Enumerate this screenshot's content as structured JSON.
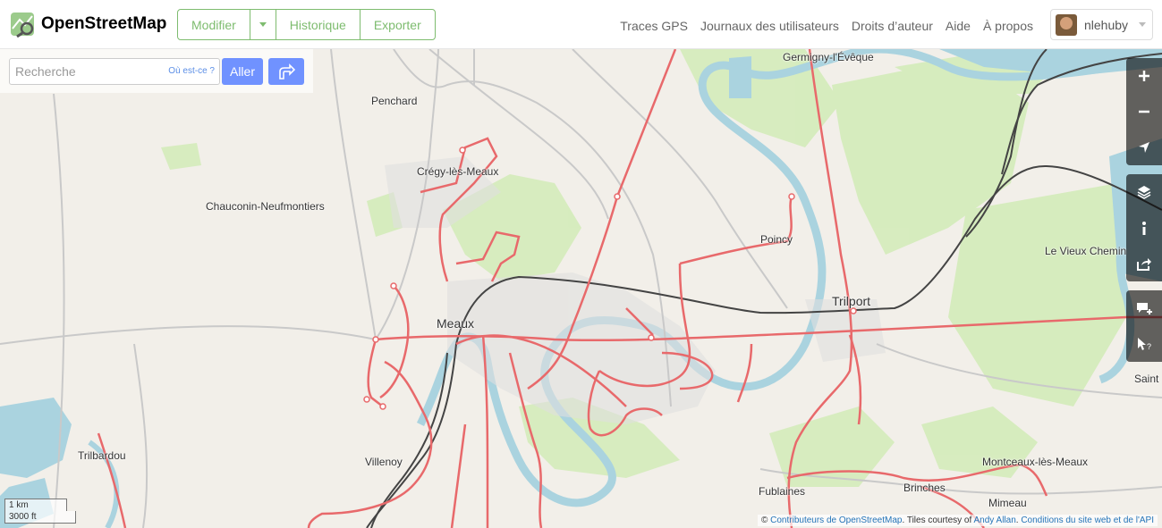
{
  "header": {
    "logo_text": "OpenStreetMap",
    "edit_label": "Modifier",
    "history_label": "Historique",
    "export_label": "Exporter",
    "nav": [
      "Traces GPS",
      "Journaux des utilisateurs",
      "Droits d’auteur",
      "Aide",
      "À propos"
    ],
    "username": "nlehuby"
  },
  "search": {
    "placeholder": "Recherche",
    "where_label": "Où est-ce ?",
    "go_label": "Aller"
  },
  "map_controls": [
    "zoom-in-icon",
    "zoom-out-icon",
    "locate-icon",
    "layers-icon",
    "info-icon",
    "share-icon",
    "note-icon",
    "query-icon"
  ],
  "scale": {
    "metric": "1 km",
    "imperial": "3000 ft"
  },
  "attribution": {
    "prefix": "©",
    "contributors": "Contributeurs de OpenStreetMap",
    "tiles_text": ". Tiles courtesy of",
    "author": "Andy Allan",
    "terms": "Conditions du site web et de l'API"
  },
  "places": {
    "germigny": "Germigny-l'Évêque",
    "penchard": "Penchard",
    "cregy": "Crégy-lès-Meaux",
    "chauconin": "Chauconin-Neufmontiers",
    "poincy": "Poincy",
    "trilport": "Trilport",
    "vieux_chemin": "Le Vieux Chemin",
    "meaux": "Meaux",
    "saint": "Saint",
    "trilbardou": "Trilbardou",
    "villenoy": "Villenoy",
    "montceaux": "Montceaux-lès-Meaux",
    "fublaines": "Fublaines",
    "brinches": "Brinches",
    "mimeau": "Mimeau"
  },
  "colors": {
    "accent": "#7ebc6f",
    "route": "#e8696b",
    "water": "#aad3df",
    "forest": "#c8facc",
    "rail": "#444444"
  }
}
